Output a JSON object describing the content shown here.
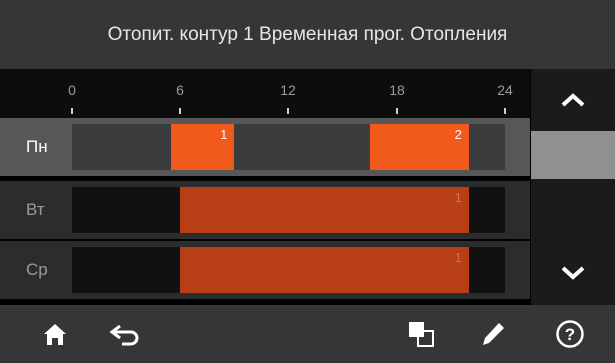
{
  "header": {
    "title": "Отопит. контур 1 Временная прог. Отопления"
  },
  "timeline": {
    "ticks": [
      0,
      6,
      12,
      18,
      24
    ],
    "tick_labels": [
      "0",
      "6",
      "12",
      "18",
      "24"
    ]
  },
  "days": [
    {
      "label": "Пн",
      "selected": true,
      "periods": [
        {
          "index": "1",
          "start": 5.5,
          "end": 9
        },
        {
          "index": "2",
          "start": 16.5,
          "end": 22
        }
      ]
    },
    {
      "label": "Вт",
      "selected": false,
      "periods": [
        {
          "index": "1",
          "start": 6,
          "end": 22
        }
      ]
    },
    {
      "label": "Ср",
      "selected": false,
      "periods": [
        {
          "index": "1",
          "start": 6,
          "end": 22
        }
      ]
    }
  ],
  "scroll": {
    "up_icon": "chevron-up-icon",
    "down_icon": "chevron-down-icon"
  },
  "footer": {
    "icons": [
      "home-icon",
      "back-icon",
      "copy-icon",
      "edit-icon",
      "help-icon"
    ],
    "help_symbol": "?"
  },
  "colors": {
    "selected_period": "#f15a1a",
    "period": "#b83e16",
    "header_bg": "#343637"
  }
}
